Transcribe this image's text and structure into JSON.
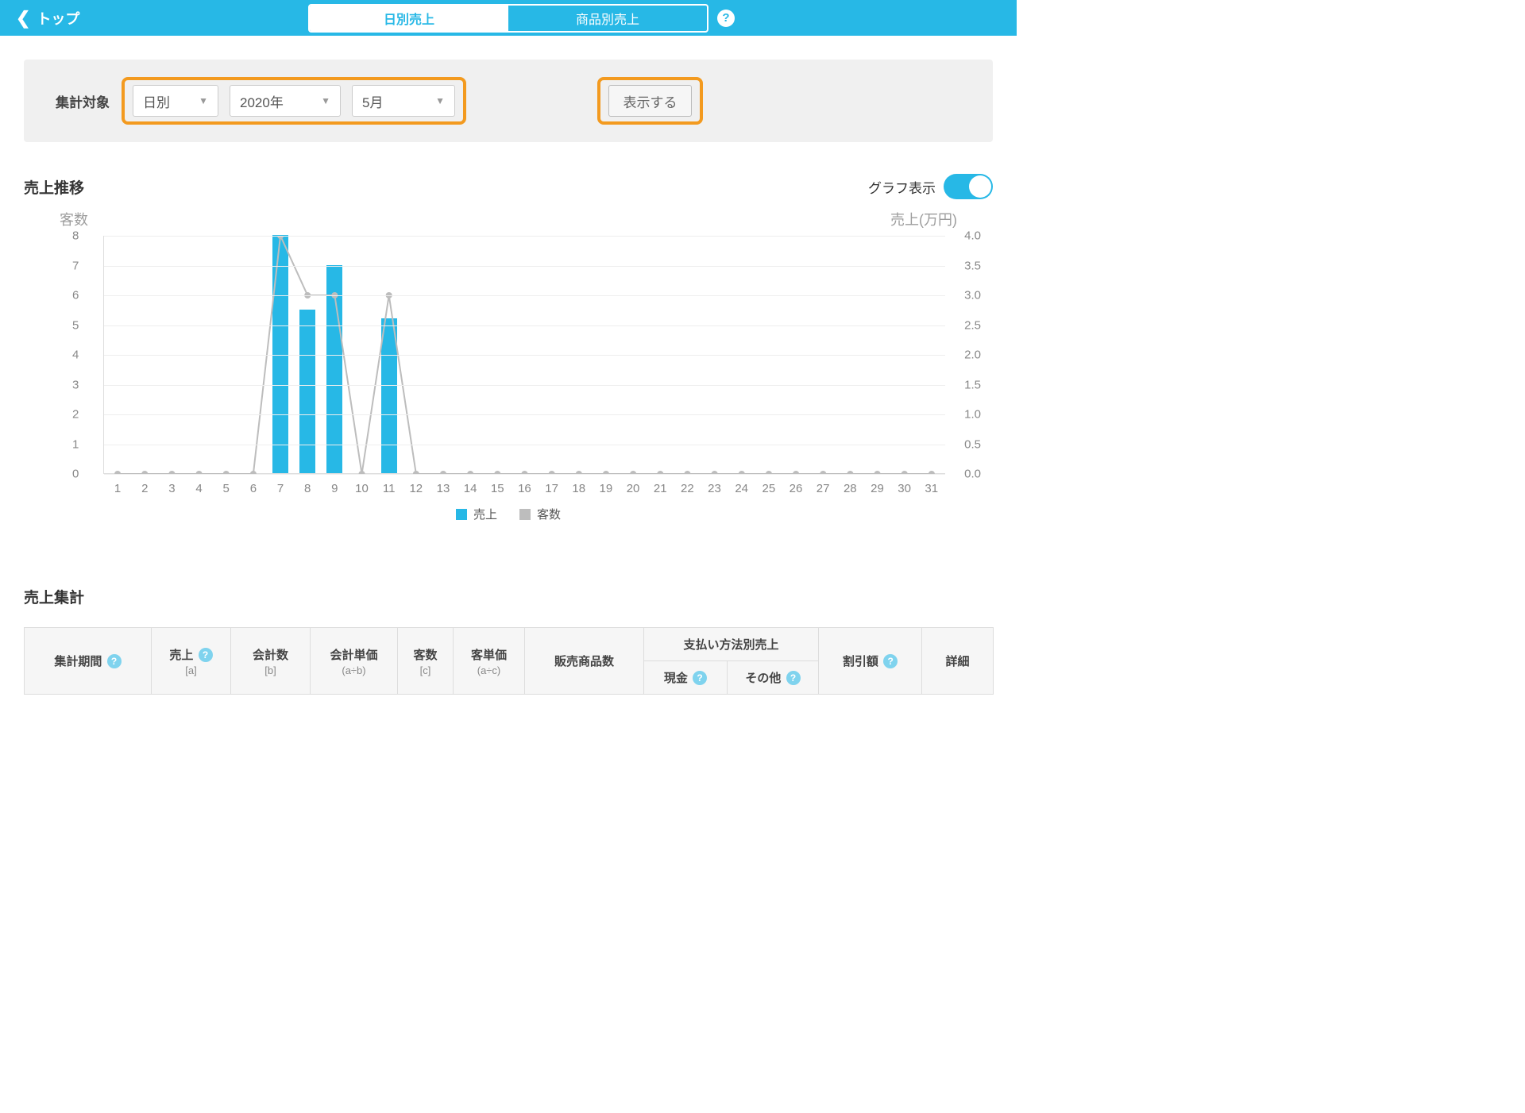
{
  "header": {
    "back_label": "トップ",
    "tab_daily": "日別売上",
    "tab_product": "商品別売上"
  },
  "filter": {
    "label": "集計対象",
    "period_type": "日別",
    "year": "2020年",
    "month": "5月",
    "button": "表示する"
  },
  "trend": {
    "title": "売上推移",
    "toggle_label": "グラフ表示",
    "axis_left": "客数",
    "axis_right": "売上(万円)",
    "legend_sales": "売上",
    "legend_customers": "客数"
  },
  "chart_data": {
    "type": "bar",
    "categories": [
      "1",
      "2",
      "3",
      "4",
      "5",
      "6",
      "7",
      "8",
      "9",
      "10",
      "11",
      "12",
      "13",
      "14",
      "15",
      "16",
      "17",
      "18",
      "19",
      "20",
      "21",
      "22",
      "23",
      "24",
      "25",
      "26",
      "27",
      "28",
      "29",
      "30",
      "31"
    ],
    "series": [
      {
        "name": "売上(万円)",
        "type": "bar",
        "axis": "right",
        "values": [
          0,
          0,
          0,
          0,
          0,
          0,
          4.0,
          2.75,
          3.5,
          0,
          2.6,
          0,
          0,
          0,
          0,
          0,
          0,
          0,
          0,
          0,
          0,
          0,
          0,
          0,
          0,
          0,
          0,
          0,
          0,
          0,
          0
        ]
      },
      {
        "name": "客数",
        "type": "line",
        "axis": "left",
        "values": [
          0,
          0,
          0,
          0,
          0,
          0,
          8,
          6,
          6,
          0,
          6,
          0,
          0,
          0,
          0,
          0,
          0,
          0,
          0,
          0,
          0,
          0,
          0,
          0,
          0,
          0,
          0,
          0,
          0,
          0,
          0
        ]
      }
    ],
    "ylim_left": [
      0,
      8
    ],
    "ylim_right": [
      0,
      4.0
    ],
    "y_ticks_left": [
      "0",
      "1",
      "2",
      "3",
      "4",
      "5",
      "6",
      "7",
      "8"
    ],
    "y_ticks_right": [
      "0.0",
      "0.5",
      "1.0",
      "1.5",
      "2.0",
      "2.5",
      "3.0",
      "3.5",
      "4.0"
    ]
  },
  "summary": {
    "title": "売上集計",
    "cols": {
      "period": "集計期間",
      "sales": "売上",
      "sales_sub": "[a]",
      "count": "会計数",
      "count_sub": "[b]",
      "avg_check": "会計単価",
      "avg_check_sub": "(a÷b)",
      "customers": "客数",
      "customers_sub": "[c]",
      "avg_customer": "客単価",
      "avg_customer_sub": "(a÷c)",
      "items_sold": "販売商品数",
      "pay_group": "支払い方法別売上",
      "pay_cash": "現金",
      "pay_other": "その他",
      "discount": "割引額",
      "detail": "詳細"
    }
  }
}
